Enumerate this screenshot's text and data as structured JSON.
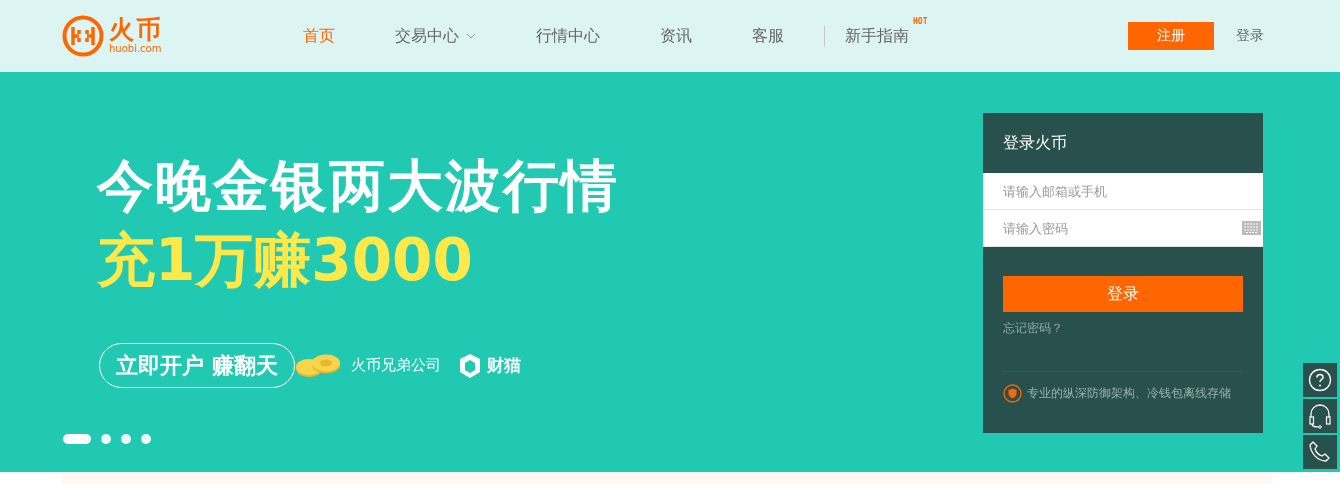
{
  "header": {
    "logo": {
      "name": "火币",
      "domain": "huobi.com"
    },
    "nav": [
      {
        "label": "首页",
        "selected": true,
        "dropdown": false,
        "divider_before": false
      },
      {
        "label": "交易中心",
        "selected": false,
        "dropdown": true,
        "divider_before": false
      },
      {
        "label": "行情中心",
        "selected": false,
        "dropdown": false,
        "divider_before": false
      },
      {
        "label": "资讯",
        "selected": false,
        "dropdown": false,
        "divider_before": false
      },
      {
        "label": "客服",
        "selected": false,
        "dropdown": false,
        "divider_before": false
      },
      {
        "label": "新手指南",
        "selected": false,
        "dropdown": false,
        "divider_before": true,
        "badge": "HOT"
      }
    ],
    "register": "注册",
    "login": "登录"
  },
  "banner": {
    "headline": "今晚金银两大波行情",
    "subhead": "充1万赚3000",
    "cta": "立即开户 赚翻天",
    "partner": "火币兄弟公司",
    "partner_brand": "财猫",
    "slides": [
      {
        "selected": true
      },
      {
        "selected": false
      },
      {
        "selected": false
      },
      {
        "selected": false
      }
    ]
  },
  "login_panel": {
    "title": "登录火币",
    "email": {
      "placeholder": "请输入邮箱或手机"
    },
    "password": {
      "placeholder": "请输入密码"
    },
    "submit": "登录",
    "forgot": "忘记密码？",
    "security_note": "专业的纵深防御架构、冷钱包离线存储"
  }
}
